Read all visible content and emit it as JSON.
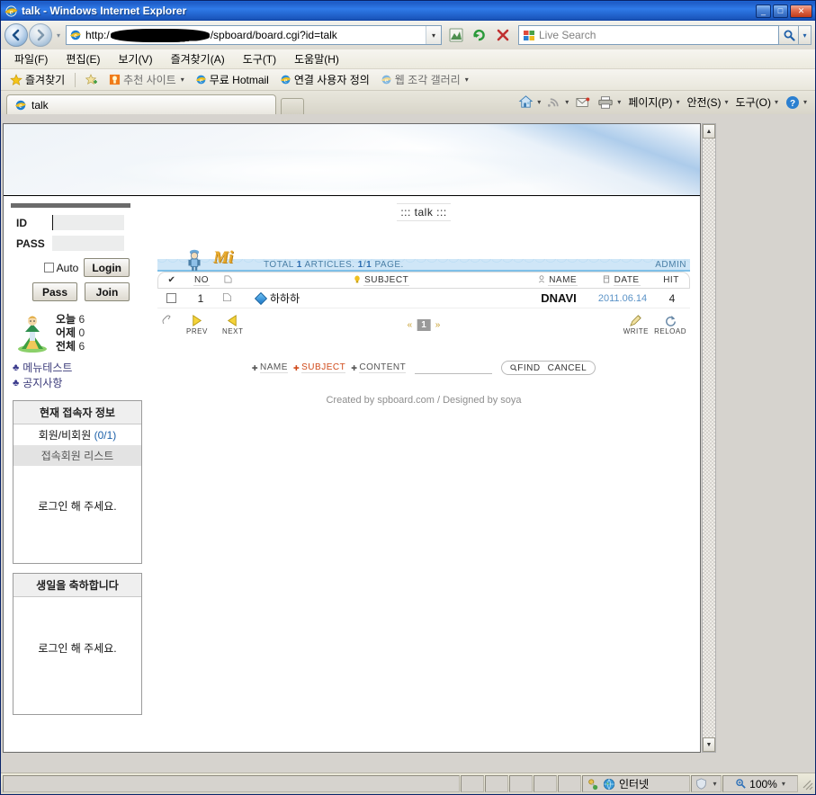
{
  "window": {
    "title": "talk - Windows Internet Explorer",
    "minimize_label": "_",
    "maximize_label": "□",
    "close_label": "✕"
  },
  "nav": {
    "back_label": "←",
    "forward_label": "→",
    "history_label": "▾",
    "url_prefix": "http:/",
    "url_suffix": "/spboard/board.cgi?id=talk",
    "url_dropdown_label": "▾",
    "compat_button": "compatibility-view",
    "refresh_button": "↻",
    "stop_button": "✕",
    "search_placeholder": "Live Search",
    "search_value": "",
    "search_go_label": "⌕",
    "search_dropdown_label": "▾"
  },
  "menubar": {
    "items": [
      {
        "label": "파일(F)"
      },
      {
        "label": "편집(E)"
      },
      {
        "label": "보기(V)"
      },
      {
        "label": "즐겨찾기(A)"
      },
      {
        "label": "도구(T)"
      },
      {
        "label": "도움말(H)"
      }
    ]
  },
  "favbar": {
    "favorites_label": "즐겨찾기",
    "items": [
      {
        "label": "추천 사이트",
        "caret": "▾",
        "dim": true
      },
      {
        "label": "무료 Hotmail",
        "caret": "",
        "dim": false
      },
      {
        "label": "연결 사용자 정의",
        "caret": "",
        "dim": false
      },
      {
        "label": "웹 조각 갤러리",
        "caret": "▾",
        "dim": true
      }
    ]
  },
  "tabs": {
    "items": [
      {
        "label": "talk"
      }
    ],
    "new_tab_label": ""
  },
  "commandbar": {
    "items": [
      {
        "name": "home-icon",
        "label": "",
        "caret": "▾"
      },
      {
        "name": "feeds-icon",
        "label": "",
        "caret": "▾"
      },
      {
        "name": "mail-icon",
        "label": "",
        "caret": ""
      },
      {
        "name": "print-icon",
        "label": "",
        "caret": "▾"
      },
      {
        "name": "page-menu",
        "label": "페이지(P)",
        "caret": "▾"
      },
      {
        "name": "safety-menu",
        "label": "안전(S)",
        "caret": "▾"
      },
      {
        "name": "tools-menu",
        "label": "도구(O)",
        "caret": "▾"
      },
      {
        "name": "help-menu",
        "label": "",
        "caret": "▾"
      }
    ]
  },
  "page": {
    "board_title": "::: talk :::",
    "login": {
      "id_label": "ID",
      "id_value": "",
      "id_placeholder": "",
      "pass_label": "PASS",
      "pass_value": "",
      "pass_placeholder": "",
      "auto_label": "Auto",
      "auto_checked": false,
      "login_button": "Login",
      "pass_button": "Pass",
      "join_button": "Join"
    },
    "counter": {
      "today_label": "오늘",
      "today_value": "6",
      "yesterday_label": "어제",
      "yesterday_value": "0",
      "total_label": "전체",
      "total_value": "6"
    },
    "menu_links": [
      {
        "bullet": "♣",
        "label": "메뉴테스트"
      },
      {
        "bullet": "♣",
        "label": "공지사항"
      }
    ],
    "visitor_box": {
      "title": "현재 접속자 정보",
      "subtitle_text": "회원/비회원 ",
      "subtitle_count": "(0/1)",
      "list_label": "접속회원 리스트",
      "body_text": "로그인 해 주세요."
    },
    "birthday_box": {
      "title": "생일을 축하합니다",
      "body_text": "로그인 해 주세요."
    },
    "board": {
      "total_text_pre": "TOTAL",
      "total_count": "1",
      "total_text_mid": "ARTICLES.",
      "page_current": "1",
      "page_sep": "/",
      "page_total": "1",
      "page_text": "PAGE.",
      "admin_label": "ADMIN",
      "columns": {
        "check": "✔",
        "no": "NO",
        "icon": "",
        "subject": "SUBJECT",
        "name": "NAME",
        "date": "DATE",
        "hit": "HIT"
      },
      "rows": [
        {
          "checked": false,
          "no": "1",
          "subject": "하하하",
          "name": "DNAVI",
          "date": "2011.06.14",
          "hit": "4"
        }
      ],
      "nav": {
        "prev_label": "PREV",
        "next_label": "NEXT",
        "write_label": "WRITE",
        "reload_label": "RELOAD",
        "page_prev_arrow": "«",
        "page_next_arrow": "»",
        "pages": [
          "1"
        ],
        "current_page": "1"
      },
      "find": {
        "opt_name": "NAME",
        "opt_subject": "SUBJECT",
        "opt_content": "CONTENT",
        "active_option": "SUBJECT",
        "input_value": "",
        "find_button": "FIND",
        "cancel_button": "CANCEL"
      },
      "credit": "Created by spboard.com / Designed by soya"
    }
  },
  "statusbar": {
    "message": "",
    "zone_label": "인터넷",
    "zoom_label": "100%",
    "zoom_caret": "▾",
    "protected_caret": "▾"
  },
  "colors": {
    "title_blue": "#1e5bc6",
    "link_blue": "#3b3b7a",
    "date_blue": "#5b93c7",
    "accent_orange": "#d04a1a",
    "wave_blue": "#7fc0e8"
  }
}
